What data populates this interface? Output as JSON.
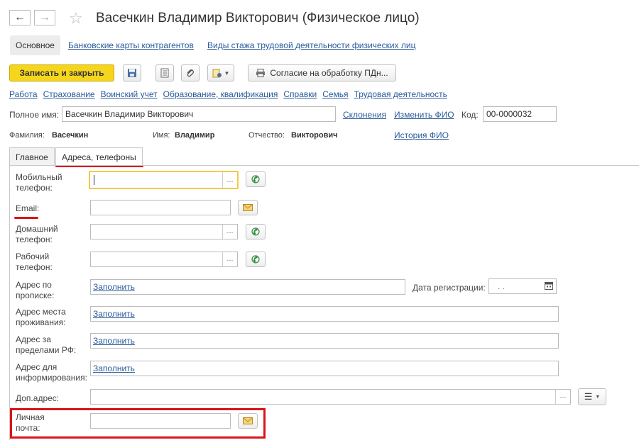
{
  "header": {
    "back_icon": "arrow-left-icon",
    "forward_icon": "arrow-right-icon",
    "star_icon": "star-icon",
    "title": "Васечкин Владимир Викторович (Физическое лицо)"
  },
  "top_tabs": [
    "Основное",
    "Банковские карты контрагентов",
    "Виды стажа трудовой деятельности физических лиц"
  ],
  "toolbar": {
    "save_close": "Записать и закрыть",
    "consent": "Согласие на обработку ПДн..."
  },
  "sublinks": [
    "Работа",
    "Страхование",
    "Воинский учет",
    "Образование, квалификация",
    "Справки",
    "Семья",
    "Трудовая деятельность"
  ],
  "name_row": {
    "full_name_label": "Полное имя:",
    "full_name_value": "Васечкин Владимир Викторович",
    "declensions": "Склонения",
    "change_fio": "Изменить ФИО",
    "code_label": "Код:",
    "code_value": "00-0000032"
  },
  "fio_row": {
    "surname_label": "Фамилия:",
    "surname_value": "Васечкин",
    "name_label": "Имя:",
    "name_value": "Владимир",
    "patronymic_label": "Отчество:",
    "patronymic_value": "Викторович",
    "history": "История ФИО"
  },
  "section_tabs": [
    "Главное",
    "Адреса, телефоны"
  ],
  "fields": {
    "mobile_line1": "Мобильный",
    "mobile_line2": "телефон:",
    "email": "Email:",
    "home_line1": "Домашний",
    "home_line2": "телефон:",
    "work_line1": "Рабочий",
    "work_line2": "телефон:",
    "reg_line1": "Адрес по",
    "reg_line2": "прописке:",
    "reg_date": "Дата регистрации:",
    "date_value": ". .",
    "live_line1": "Адрес места",
    "live_line2": "проживания:",
    "abroad_line1": "Адрес за",
    "abroad_line2": "пределами РФ:",
    "info_line1": "Адрес для",
    "info_line2": "информирования:",
    "extra": "Доп.адрес:",
    "personal_line1": "Личная",
    "personal_line2": "почта:",
    "fill": "Заполнить",
    "dots": "..."
  },
  "colors": {
    "accent_yellow": "#f5d61c",
    "link": "#2a5b9a",
    "highlight_red": "#d9141b",
    "phone_green": "#2e8b3a"
  }
}
